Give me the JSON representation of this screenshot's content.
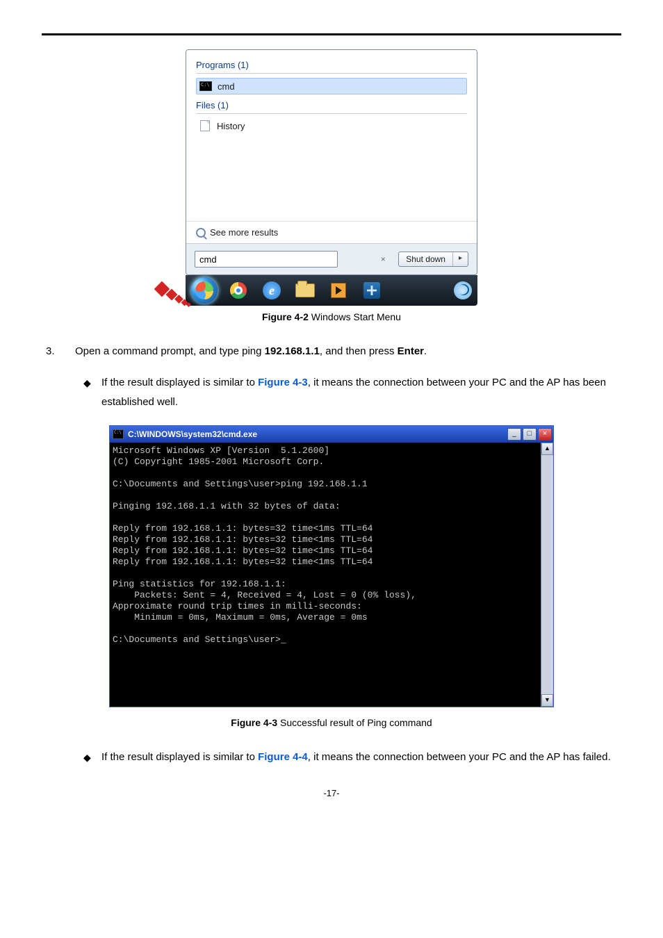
{
  "startmenu": {
    "programs_label": "Programs (1)",
    "program_item": "cmd",
    "files_label": "Files (1)",
    "file_item": "History",
    "more_results": "See more results",
    "search_value": "cmd",
    "clear_symbol": "×",
    "shutdown_label": "Shut down",
    "shutdown_arrow": "▸"
  },
  "figcap1_bold": "Figure 4-2",
  "figcap1_rest": " Windows Start Menu",
  "step3_num": "3.",
  "step3_a": "Open a command prompt, and type ping ",
  "step3_ip": "192.168.1.1",
  "step3_b": ", and then press ",
  "step3_enter": "Enter",
  "step3_c": ".",
  "bullet1_a": "If the result displayed is similar to ",
  "bullet1_link": "Figure 4-3",
  "bullet1_b": ", it means the connection between your PC and the AP has been established well.",
  "cmd": {
    "title": "C:\\WINDOWS\\system32\\cmd.exe",
    "body": "Microsoft Windows XP [Version  5.1.2600]\n(C) Copyright 1985-2001 Microsoft Corp.\n\nC:\\Documents and Settings\\user>ping 192.168.1.1\n\nPinging 192.168.1.1 with 32 bytes of data:\n\nReply from 192.168.1.1: bytes=32 time<1ms TTL=64\nReply from 192.168.1.1: bytes=32 time<1ms TTL=64\nReply from 192.168.1.1: bytes=32 time<1ms TTL=64\nReply from 192.168.1.1: bytes=32 time<1ms TTL=64\n\nPing statistics for 192.168.1.1:\n    Packets: Sent = 4, Received = 4, Lost = 0 (0% loss),\nApproximate round trip times in milli-seconds:\n    Minimum = 0ms, Maximum = 0ms, Average = 0ms\n\nC:\\Documents and Settings\\user>_",
    "min": "_",
    "max": "□",
    "close": "×",
    "up": "▲",
    "down": "▼"
  },
  "figcap2_bold": "Figure 4-3",
  "figcap2_rest": " Successful result of Ping command",
  "bullet2_a": "If the result displayed is similar to ",
  "bullet2_link": "Figure 4-4",
  "bullet2_b": ", it means the connection between your PC and the AP has failed.",
  "page_number": "-17-"
}
